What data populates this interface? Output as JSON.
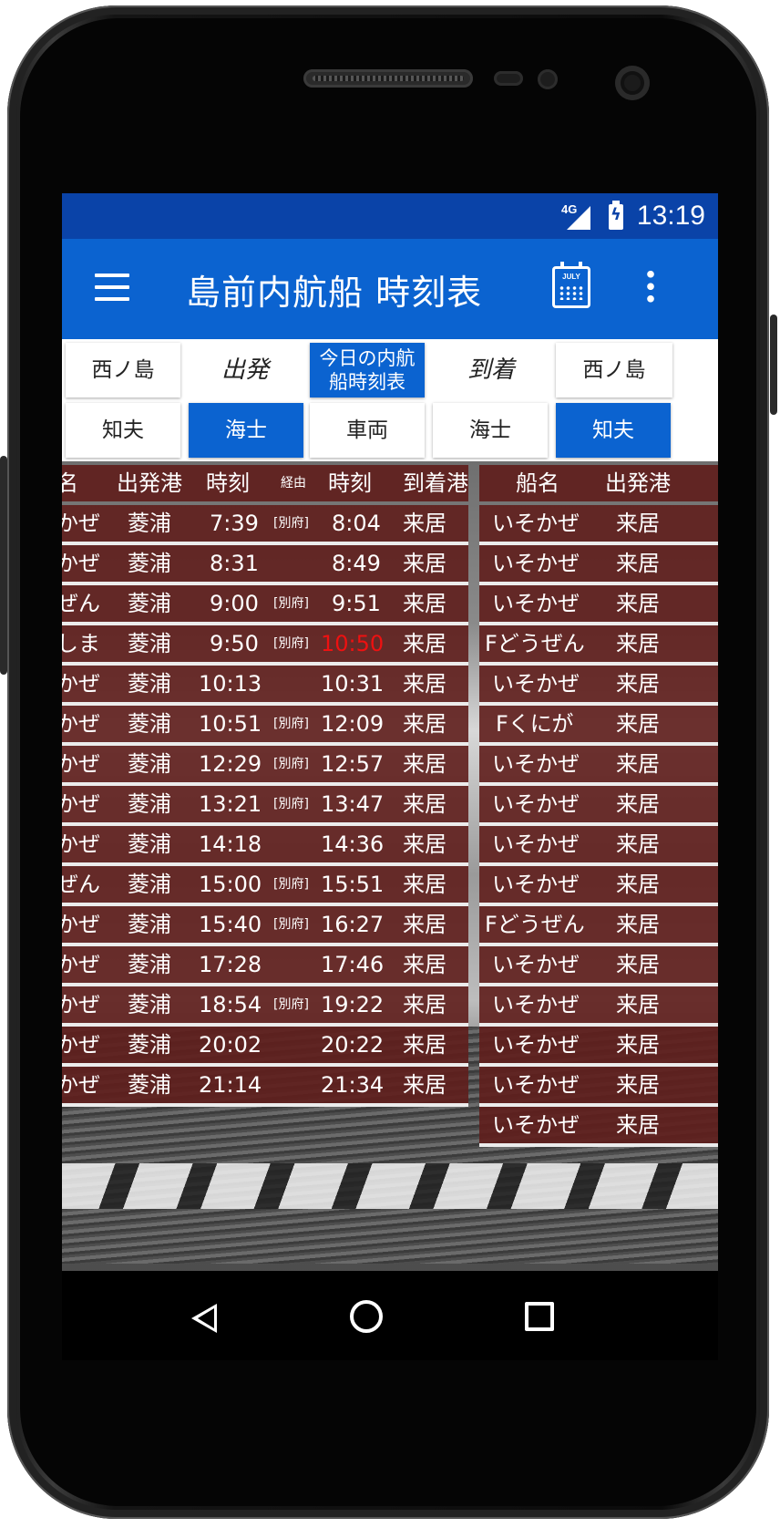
{
  "status_bar": {
    "network": "4G",
    "time": "13:19"
  },
  "app_bar": {
    "title": "島前内航船 時刻表",
    "menu_icon": "hamburger-menu-icon",
    "calendar_icon_text": "JULY",
    "more_icon": "more-vertical-icon"
  },
  "selector": {
    "from_port": "西ノ島",
    "departure_label": "出発",
    "today_label": "今日の内航\n船時刻表",
    "arrival_label": "到着",
    "to_port": "西ノ島",
    "row2": [
      "知夫",
      "海士",
      "車両",
      "海士",
      "知夫"
    ],
    "row2_active": [
      false,
      true,
      false,
      false,
      true
    ]
  },
  "left_table": {
    "headers": [
      "名",
      "出発港",
      "時刻",
      "経由",
      "時刻",
      "到着港"
    ],
    "rows": [
      {
        "ship": "かぜ",
        "from": "菱浦",
        "dep": "7:39",
        "via": "[別府]",
        "arr": "8:04",
        "to": "来居"
      },
      {
        "ship": "かぜ",
        "from": "菱浦",
        "dep": "8:31",
        "via": "",
        "arr": "8:49",
        "to": "来居"
      },
      {
        "ship": "ぜん",
        "from": "菱浦",
        "dep": "9:00",
        "via": "[別府]",
        "arr": "9:51",
        "to": "来居"
      },
      {
        "ship": "しま",
        "from": "菱浦",
        "dep": "9:50",
        "via": "[別府]",
        "arr": "10:50",
        "to": "来居",
        "arr_red": true
      },
      {
        "ship": "かぜ",
        "from": "菱浦",
        "dep": "10:13",
        "via": "",
        "arr": "10:31",
        "to": "来居"
      },
      {
        "ship": "かぜ",
        "from": "菱浦",
        "dep": "10:51",
        "via": "[別府]",
        "arr": "12:09",
        "to": "来居"
      },
      {
        "ship": "かぜ",
        "from": "菱浦",
        "dep": "12:29",
        "via": "[別府]",
        "arr": "12:57",
        "to": "来居"
      },
      {
        "ship": "かぜ",
        "from": "菱浦",
        "dep": "13:21",
        "via": "[別府]",
        "arr": "13:47",
        "to": "来居"
      },
      {
        "ship": "かぜ",
        "from": "菱浦",
        "dep": "14:18",
        "via": "",
        "arr": "14:36",
        "to": "来居"
      },
      {
        "ship": "ぜん",
        "from": "菱浦",
        "dep": "15:00",
        "via": "[別府]",
        "arr": "15:51",
        "to": "来居"
      },
      {
        "ship": "かぜ",
        "from": "菱浦",
        "dep": "15:40",
        "via": "[別府]",
        "arr": "16:27",
        "to": "来居"
      },
      {
        "ship": "かぜ",
        "from": "菱浦",
        "dep": "17:28",
        "via": "",
        "arr": "17:46",
        "to": "来居"
      },
      {
        "ship": "かぜ",
        "from": "菱浦",
        "dep": "18:54",
        "via": "[別府]",
        "arr": "19:22",
        "to": "来居"
      },
      {
        "ship": "かぜ",
        "from": "菱浦",
        "dep": "20:02",
        "via": "",
        "arr": "20:22",
        "to": "来居"
      },
      {
        "ship": "かぜ",
        "from": "菱浦",
        "dep": "21:14",
        "via": "",
        "arr": "21:34",
        "to": "来居"
      }
    ]
  },
  "right_table": {
    "headers": [
      "船名",
      "出発港"
    ],
    "rows": [
      {
        "ship": "いそかぜ",
        "from": "来居"
      },
      {
        "ship": "いそかぜ",
        "from": "来居"
      },
      {
        "ship": "いそかぜ",
        "from": "来居"
      },
      {
        "ship": "Fどうぜん",
        "from": "来居"
      },
      {
        "ship": "いそかぜ",
        "from": "来居"
      },
      {
        "ship": "Fくにが",
        "from": "来居"
      },
      {
        "ship": "いそかぜ",
        "from": "来居"
      },
      {
        "ship": "いそかぜ",
        "from": "来居"
      },
      {
        "ship": "いそかぜ",
        "from": "来居"
      },
      {
        "ship": "いそかぜ",
        "from": "来居"
      },
      {
        "ship": "Fどうぜん",
        "from": "来居"
      },
      {
        "ship": "いそかぜ",
        "from": "来居"
      },
      {
        "ship": "いそかぜ",
        "from": "来居"
      },
      {
        "ship": "いそかぜ",
        "from": "来居"
      },
      {
        "ship": "いそかぜ",
        "from": "来居"
      },
      {
        "ship": "いそかぜ",
        "from": "来居"
      }
    ]
  },
  "colors": {
    "primary": "#0b63d0",
    "status": "#0a43a8",
    "row_bg": "#5f1e1c",
    "highlight": "#ee1111"
  },
  "nav_bar": {
    "back": "back-triangle-icon",
    "home": "home-circle-icon",
    "recent": "recent-square-icon"
  }
}
